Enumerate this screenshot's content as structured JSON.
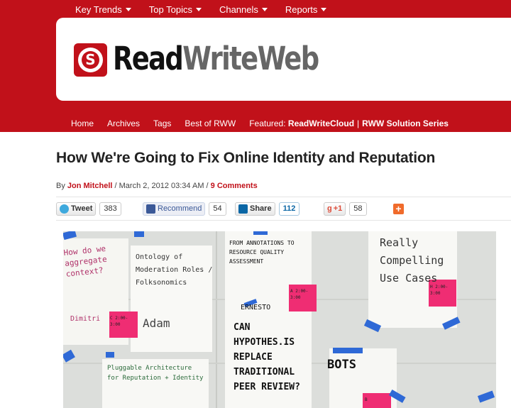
{
  "top_nav": [
    {
      "label": "Key Trends"
    },
    {
      "label": "Top Topics"
    },
    {
      "label": "Channels"
    },
    {
      "label": "Reports"
    }
  ],
  "logo": {
    "read": "Read",
    "write": "Write",
    "web": "Web"
  },
  "sub_nav": {
    "items": [
      "Home",
      "Archives",
      "Tags",
      "Best of RWW"
    ],
    "featured_label": "Featured:",
    "featured_1": "ReadWriteCloud",
    "separator": "|",
    "featured_2": "RWW Solution Series"
  },
  "article": {
    "title": "How We're Going to Fix Online Identity and Reputation",
    "by": "By",
    "author": "Jon Mitchell",
    "date": "/ March 2, 2012 03:34 AM /",
    "comments": "9 Comments"
  },
  "share": {
    "tweet_label": "Tweet",
    "tweet_count": "383",
    "fb_label": "Recommend",
    "fb_count": "54",
    "li_label": "Share",
    "li_count": "112",
    "gp_label": "+1",
    "gp_count": "58",
    "plus_symbol": "+"
  },
  "photo_notes": {
    "n1": "How do we aggregate context?",
    "n2": "Ontology of Moderation Roles / Folksonomics",
    "n3": "Dimitri",
    "n4": "Adam",
    "n5": "FROM ANNOTATIONS TO RESOURCE QUALITY ASSESSMENT",
    "n6": "ERNESTO",
    "n7": "CAN HYPOTHES.IS REPLACE TRADITIONAL PEER REVIEW?",
    "n8": "BOTS",
    "n9": "Really Compelling Use Cases",
    "n10": "Pluggable Architecture for Reputation + Identity",
    "sticky_a": "A 2:00-3:00",
    "sticky_c": "C 2:00-3:00",
    "sticky_h": "H 2:00-3:00",
    "sticky_b": "B"
  },
  "colors": {
    "brand_red": "#c1111a",
    "link_red": "#c1111a"
  }
}
